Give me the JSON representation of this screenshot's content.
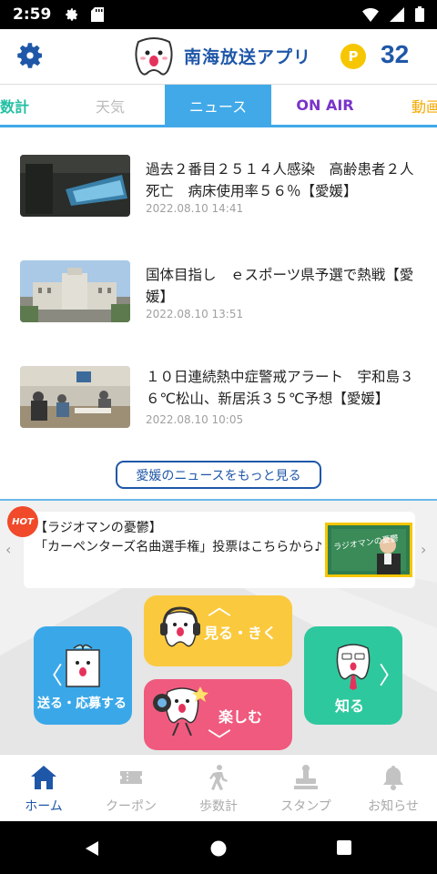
{
  "status": {
    "time": "2:59"
  },
  "header": {
    "app_title": "南海放送アプリ",
    "point_badge": "P",
    "points": "32"
  },
  "tabs": [
    {
      "label": "数計"
    },
    {
      "label": "天気"
    },
    {
      "label": "ニュース"
    },
    {
      "label": "ON AIR"
    },
    {
      "label": "動画"
    }
  ],
  "news": [
    {
      "headline": "過去２番目２５１４人感染　高齢患者２人死亡　病床使用率５６％【愛媛】",
      "date": "2022.08.10 14:41"
    },
    {
      "headline": "国体目指し　ｅスポーツ県予選で熱戦【愛媛】",
      "date": "2022.08.10 13:51"
    },
    {
      "headline": "１０日連続熱中症警戒アラート　宇和島３６℃松山、新居浜３５℃予想【愛媛】",
      "date": "2022.08.10 10:05"
    }
  ],
  "more_button": "愛媛のニュースをもっと見る",
  "banner": {
    "hot_badge": "HOT",
    "text": "【ラジオマンの憂鬱】\n「カーペンターズ名曲選手権」投票はこちらから♪",
    "image_caption": "ラジオマンの憂鬱"
  },
  "categories": {
    "watch_listen": "見る・きく",
    "send_apply": "送る・応募する",
    "enjoy": "楽しむ",
    "know": "知る"
  },
  "bottom_nav": [
    {
      "label": "ホーム"
    },
    {
      "label": "クーポン"
    },
    {
      "label": "歩数計"
    },
    {
      "label": "スタンプ"
    },
    {
      "label": "お知らせ"
    }
  ],
  "colors": {
    "brand": "#1f57a8",
    "tab_active": "#41a9e8",
    "watch_listen": "#fbc93d",
    "send_apply": "#3aa8e8",
    "enjoy": "#f05a7e",
    "know": "#2ec89e"
  }
}
